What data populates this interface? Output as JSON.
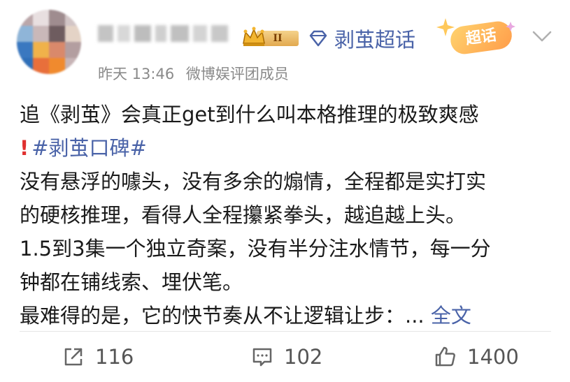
{
  "header": {
    "topic_label": "剥茧超话",
    "chaohua_badge": "超话",
    "vip_badge": "II",
    "timestamp": "昨天 13:46",
    "member_label": "微博娱评团成员"
  },
  "post": {
    "line1": "追《剥茧》会真正get到什么叫本格推理的极致爽感",
    "hashtag": "#剥茧口碑#",
    "line3": "没有悬浮的噱头，没有多余的煽情，全程都是实打实",
    "line4": "的硬核推理，看得人全程攥紧拳头，越追越上头。",
    "line5": "1.5到3集一个独立奇案，没有半分注水情节，每一分",
    "line6": "钟都在铺线索、埋伏笔。",
    "line7": "最难得的是，它的快节奏从不让逻辑让步：...",
    "full_text_link": "全文"
  },
  "actions": {
    "share_count": "116",
    "comment_count": "102",
    "like_count": "1400"
  },
  "colors": {
    "link_blue": "#4a63a8",
    "meta_gray": "#8a8a8a",
    "alert_red": "#e0302f"
  },
  "icons": [
    "chevron-down-icon",
    "diamond-icon",
    "crown-icon",
    "share-icon",
    "comment-icon",
    "like-icon"
  ]
}
